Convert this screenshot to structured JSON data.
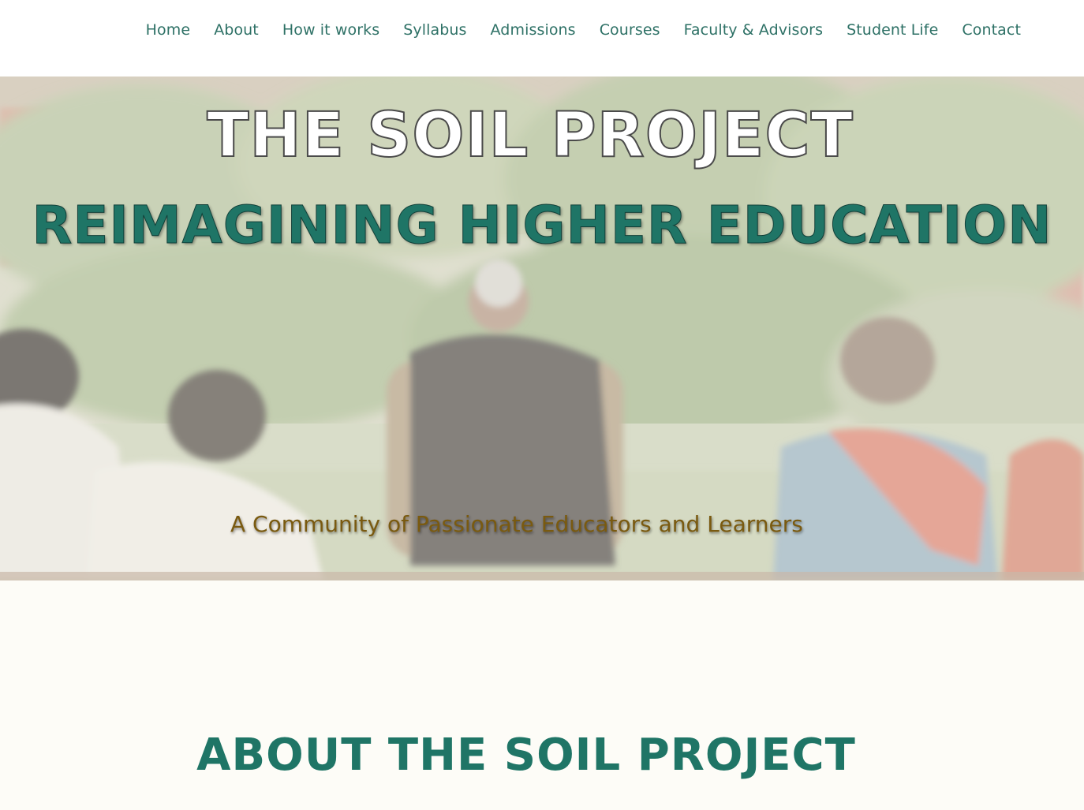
{
  "nav": {
    "items": [
      {
        "label": "Home",
        "name": "nav-home"
      },
      {
        "label": "About",
        "name": "nav-about"
      },
      {
        "label": "How it works",
        "name": "nav-how-it-works"
      },
      {
        "label": "Syllabus",
        "name": "nav-syllabus"
      },
      {
        "label": "Admissions",
        "name": "nav-admissions"
      },
      {
        "label": "Courses",
        "name": "nav-courses"
      },
      {
        "label": "Faculty & Advisors",
        "name": "nav-faculty-advisors"
      },
      {
        "label": "Student Life",
        "name": "nav-student-life"
      },
      {
        "label": "Contact",
        "name": "nav-contact"
      }
    ]
  },
  "hero": {
    "title": "THE SOIL PROJECT",
    "subtitle": "REIMAGINING HIGHER EDUCATION",
    "tagline": "A Community of Passionate Educators and Learners"
  },
  "about": {
    "heading": "ABOUT THE SOIL PROJECT"
  },
  "colors": {
    "brand_green": "#1f7566",
    "nav_text": "#2e7166",
    "tagline_gold": "#7a5a10",
    "page_bg": "#fdfcf7"
  }
}
